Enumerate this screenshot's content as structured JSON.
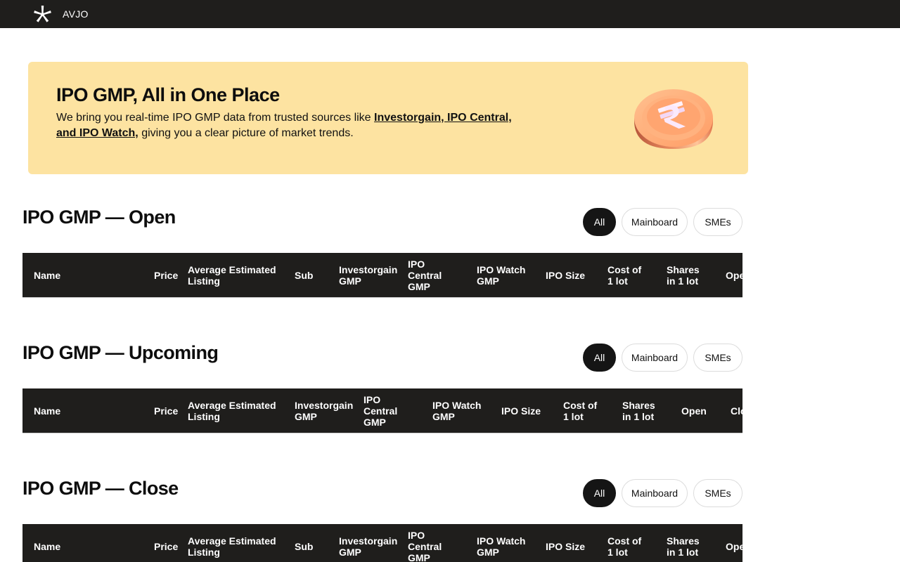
{
  "app": {
    "brand": "AVJO"
  },
  "hero": {
    "title": "IPO GMP, All in One Place",
    "text_before": "We bring you real-time IPO GMP data from trusted sources like ",
    "link_text": "Investorgain, IPO Central, and IPO Watch,",
    "text_after": " giving you a clear picture of market trends."
  },
  "filters": {
    "all": "All",
    "mainboard": "Mainboard",
    "smes": "SMEs",
    "active": "All"
  },
  "sections": {
    "open": {
      "title": "IPO GMP — Open",
      "columns": [
        "Name",
        "Price",
        "Average Estimated\nListing",
        "Sub",
        "Investorgain\nGMP",
        "IPO\nCentral\nGMP",
        "IPO Watch\nGMP",
        "IPO Size",
        "Cost of\n1 lot",
        "Shares\nin 1 lot",
        "Open"
      ]
    },
    "upcoming": {
      "title": "IPO GMP — Upcoming",
      "columns": [
        "Name",
        "Price",
        "Average Estimated\nListing",
        "Investorgain\nGMP",
        "IPO\nCentral\nGMP",
        "IPO Watch\nGMP",
        "IPO Size",
        "Cost of\n1 lot",
        "Shares\nin 1 lot",
        "Open",
        "Close"
      ]
    },
    "close": {
      "title": "IPO GMP — Close",
      "columns": [
        "Name",
        "Price",
        "Average Estimated\nListing",
        "Sub",
        "Investorgain\nGMP",
        "IPO\nCentral\nGMP",
        "IPO Watch\nGMP",
        "IPO Size",
        "Cost of\n1 lot",
        "Shares\nin 1 lot",
        "Open"
      ]
    }
  },
  "icons": {
    "logo": "asterisk-logo-icon",
    "coin": "rupee-coin-icon"
  },
  "colors": {
    "topbar": "#1f1e1c",
    "hero_bg": "#fde3a1",
    "active_pill": "#151515"
  }
}
